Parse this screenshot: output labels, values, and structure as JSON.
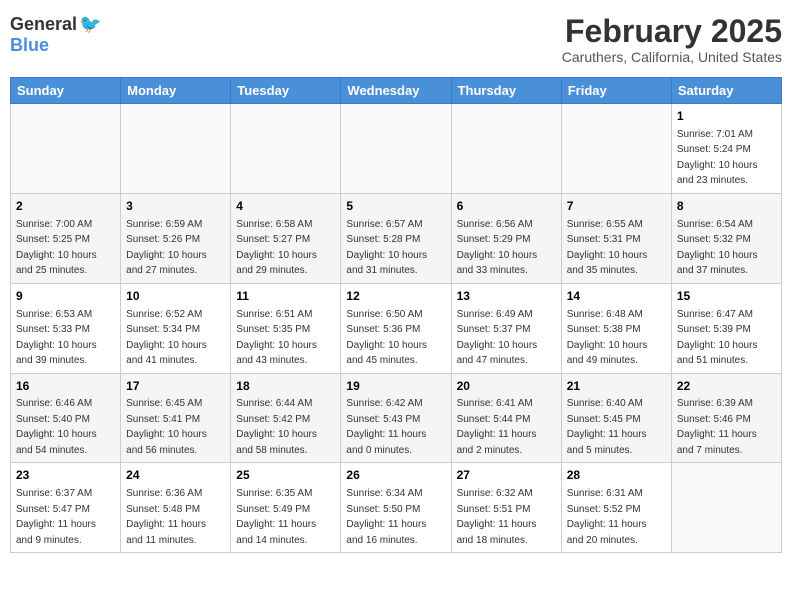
{
  "header": {
    "logo_general": "General",
    "logo_blue": "Blue",
    "month": "February 2025",
    "location": "Caruthers, California, United States"
  },
  "days_of_week": [
    "Sunday",
    "Monday",
    "Tuesday",
    "Wednesday",
    "Thursday",
    "Friday",
    "Saturday"
  ],
  "weeks": [
    [
      {
        "day": "",
        "info": ""
      },
      {
        "day": "",
        "info": ""
      },
      {
        "day": "",
        "info": ""
      },
      {
        "day": "",
        "info": ""
      },
      {
        "day": "",
        "info": ""
      },
      {
        "day": "",
        "info": ""
      },
      {
        "day": "1",
        "info": "Sunrise: 7:01 AM\nSunset: 5:24 PM\nDaylight: 10 hours and 23 minutes."
      }
    ],
    [
      {
        "day": "2",
        "info": "Sunrise: 7:00 AM\nSunset: 5:25 PM\nDaylight: 10 hours and 25 minutes."
      },
      {
        "day": "3",
        "info": "Sunrise: 6:59 AM\nSunset: 5:26 PM\nDaylight: 10 hours and 27 minutes."
      },
      {
        "day": "4",
        "info": "Sunrise: 6:58 AM\nSunset: 5:27 PM\nDaylight: 10 hours and 29 minutes."
      },
      {
        "day": "5",
        "info": "Sunrise: 6:57 AM\nSunset: 5:28 PM\nDaylight: 10 hours and 31 minutes."
      },
      {
        "day": "6",
        "info": "Sunrise: 6:56 AM\nSunset: 5:29 PM\nDaylight: 10 hours and 33 minutes."
      },
      {
        "day": "7",
        "info": "Sunrise: 6:55 AM\nSunset: 5:31 PM\nDaylight: 10 hours and 35 minutes."
      },
      {
        "day": "8",
        "info": "Sunrise: 6:54 AM\nSunset: 5:32 PM\nDaylight: 10 hours and 37 minutes."
      }
    ],
    [
      {
        "day": "9",
        "info": "Sunrise: 6:53 AM\nSunset: 5:33 PM\nDaylight: 10 hours and 39 minutes."
      },
      {
        "day": "10",
        "info": "Sunrise: 6:52 AM\nSunset: 5:34 PM\nDaylight: 10 hours and 41 minutes."
      },
      {
        "day": "11",
        "info": "Sunrise: 6:51 AM\nSunset: 5:35 PM\nDaylight: 10 hours and 43 minutes."
      },
      {
        "day": "12",
        "info": "Sunrise: 6:50 AM\nSunset: 5:36 PM\nDaylight: 10 hours and 45 minutes."
      },
      {
        "day": "13",
        "info": "Sunrise: 6:49 AM\nSunset: 5:37 PM\nDaylight: 10 hours and 47 minutes."
      },
      {
        "day": "14",
        "info": "Sunrise: 6:48 AM\nSunset: 5:38 PM\nDaylight: 10 hours and 49 minutes."
      },
      {
        "day": "15",
        "info": "Sunrise: 6:47 AM\nSunset: 5:39 PM\nDaylight: 10 hours and 51 minutes."
      }
    ],
    [
      {
        "day": "16",
        "info": "Sunrise: 6:46 AM\nSunset: 5:40 PM\nDaylight: 10 hours and 54 minutes."
      },
      {
        "day": "17",
        "info": "Sunrise: 6:45 AM\nSunset: 5:41 PM\nDaylight: 10 hours and 56 minutes."
      },
      {
        "day": "18",
        "info": "Sunrise: 6:44 AM\nSunset: 5:42 PM\nDaylight: 10 hours and 58 minutes."
      },
      {
        "day": "19",
        "info": "Sunrise: 6:42 AM\nSunset: 5:43 PM\nDaylight: 11 hours and 0 minutes."
      },
      {
        "day": "20",
        "info": "Sunrise: 6:41 AM\nSunset: 5:44 PM\nDaylight: 11 hours and 2 minutes."
      },
      {
        "day": "21",
        "info": "Sunrise: 6:40 AM\nSunset: 5:45 PM\nDaylight: 11 hours and 5 minutes."
      },
      {
        "day": "22",
        "info": "Sunrise: 6:39 AM\nSunset: 5:46 PM\nDaylight: 11 hours and 7 minutes."
      }
    ],
    [
      {
        "day": "23",
        "info": "Sunrise: 6:37 AM\nSunset: 5:47 PM\nDaylight: 11 hours and 9 minutes."
      },
      {
        "day": "24",
        "info": "Sunrise: 6:36 AM\nSunset: 5:48 PM\nDaylight: 11 hours and 11 minutes."
      },
      {
        "day": "25",
        "info": "Sunrise: 6:35 AM\nSunset: 5:49 PM\nDaylight: 11 hours and 14 minutes."
      },
      {
        "day": "26",
        "info": "Sunrise: 6:34 AM\nSunset: 5:50 PM\nDaylight: 11 hours and 16 minutes."
      },
      {
        "day": "27",
        "info": "Sunrise: 6:32 AM\nSunset: 5:51 PM\nDaylight: 11 hours and 18 minutes."
      },
      {
        "day": "28",
        "info": "Sunrise: 6:31 AM\nSunset: 5:52 PM\nDaylight: 11 hours and 20 minutes."
      },
      {
        "day": "",
        "info": ""
      }
    ]
  ]
}
